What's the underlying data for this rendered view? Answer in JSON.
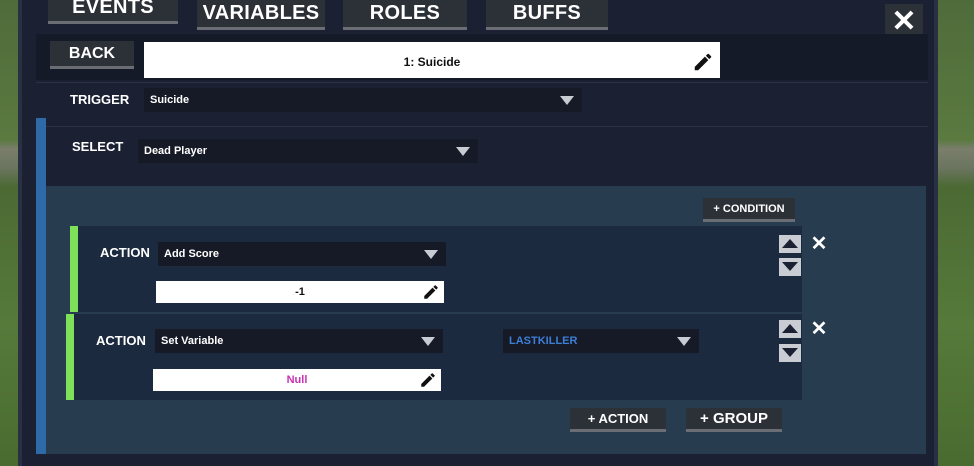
{
  "tabs": [
    {
      "label": "EVENTS"
    },
    {
      "label": "VARIABLES"
    },
    {
      "label": "ROLES"
    },
    {
      "label": "BUFFS"
    }
  ],
  "close_label": "✕",
  "back_label": "BACK",
  "event_name": "1: Suicide",
  "trigger": {
    "label": "TRIGGER",
    "value": "Suicide"
  },
  "select": {
    "label": "SELECT",
    "value": "Dead Player"
  },
  "add_condition_label": "+ CONDITION",
  "actions": [
    {
      "label": "ACTION",
      "type": "Add Score",
      "value": "-1"
    },
    {
      "label": "ACTION",
      "type": "Set Variable",
      "variable": "LASTKILLER",
      "value": "Null"
    }
  ],
  "add_action_label": "+ ACTION",
  "add_group_label": "+ GROUP",
  "colors": {
    "panel": "#1b2133",
    "section_bar": "#2f6aa8",
    "action_bar": "#7fe05a",
    "variable_text": "#3d7fd6",
    "null_text": "#c832b4"
  },
  "icons": [
    "pencil-icon",
    "chevron-down-icon",
    "arrow-up-icon",
    "arrow-down-icon",
    "close-icon"
  ]
}
